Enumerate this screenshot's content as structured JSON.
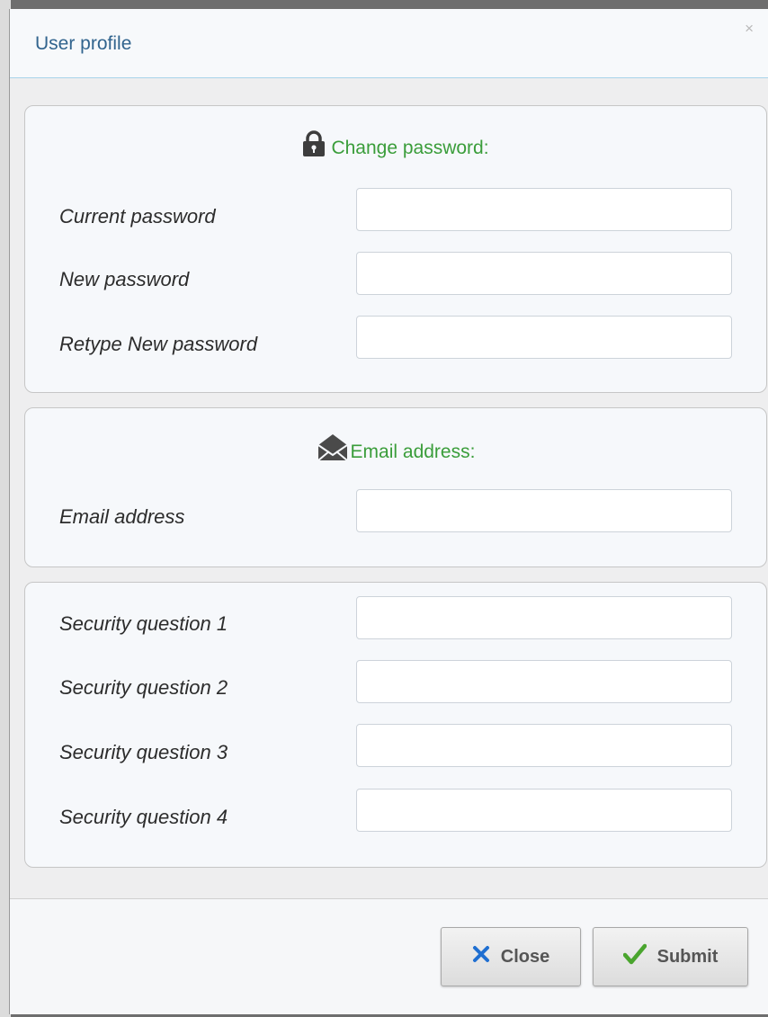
{
  "dialog": {
    "title": "User profile",
    "close_glyph": "×"
  },
  "password_section": {
    "icon": "lock-icon",
    "title": "Change password:",
    "fields": [
      {
        "label": "Current password",
        "value": ""
      },
      {
        "label": "New password",
        "value": ""
      },
      {
        "label": "Retype New password",
        "value": ""
      }
    ]
  },
  "email_section": {
    "icon": "envelope-icon",
    "title": "Email address:",
    "fields": [
      {
        "label": "Email address",
        "value": ""
      }
    ]
  },
  "security_section": {
    "fields": [
      {
        "label": "Security question 1",
        "value": ""
      },
      {
        "label": "Security question 2",
        "value": ""
      },
      {
        "label": "Security question 3",
        "value": ""
      },
      {
        "label": "Security question 4",
        "value": ""
      }
    ]
  },
  "footer": {
    "close_label": "Close",
    "submit_label": "Submit"
  },
  "colors": {
    "title_blue": "#31648e",
    "section_green": "#3a9d3a",
    "close_icon_blue": "#1f6fd1",
    "check_green": "#4aa52e"
  }
}
